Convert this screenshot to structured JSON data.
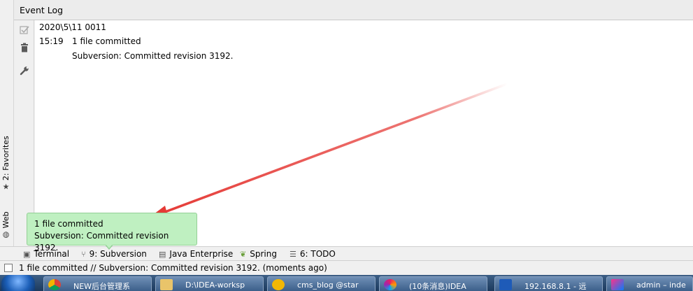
{
  "panel": {
    "title": "Event Log"
  },
  "left_strip": {
    "favorites_label": "2: Favorites",
    "web_label": "Web"
  },
  "log": {
    "date": "2020\\5\\11 0011",
    "time": "15:19",
    "message": "1 file committed",
    "detail": "Subversion: Committed revision 3192."
  },
  "balloon": {
    "title": "1 file committed",
    "body": "Subversion: Committed revision 3192."
  },
  "tool_tabs": [
    {
      "label": "Terminal",
      "icon": "terminal-icon"
    },
    {
      "label": "9: Subversion",
      "icon": "vcs-icon"
    },
    {
      "label": "Java Enterprise",
      "icon": "java-enterprise-icon"
    },
    {
      "label": "Spring",
      "icon": "spring-leaf-icon"
    },
    {
      "label": "6: TODO",
      "icon": "todo-list-icon"
    }
  ],
  "status_bar": {
    "text": "1 file committed // Subversion: Committed revision 3192. (moments ago)"
  },
  "taskbar": {
    "items": [
      {
        "label": "NEW后台管理系",
        "icon": "chrome-icon"
      },
      {
        "label": "D:\\IDEA-worksp",
        "icon": "folder-icon"
      },
      {
        "label": "cms_blog @star",
        "icon": "database-icon"
      },
      {
        "label": "(10条消息)IDEA",
        "icon": "browser-icon"
      },
      {
        "label": "192.168.8.1 - 远",
        "icon": "remote-desktop-icon"
      },
      {
        "label": "admin – inde",
        "icon": "intellij-icon"
      }
    ]
  },
  "colors": {
    "balloon_bg": "#bff0c1",
    "balloon_border": "#93cf95",
    "annotation_arrow": "#e53935"
  }
}
